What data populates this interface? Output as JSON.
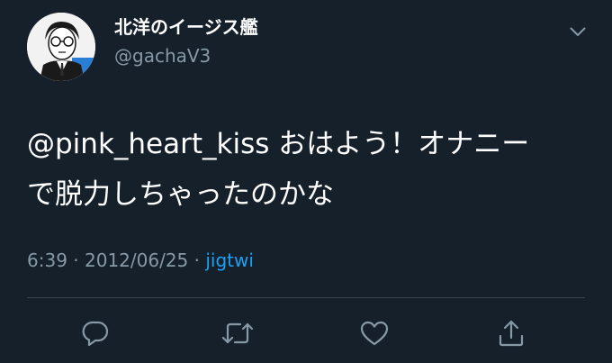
{
  "user": {
    "display_name": "北洋のイージス艦",
    "handle": "@gachaV3"
  },
  "tweet": {
    "mention": "@pink_heart_kiss",
    "line1_rest": " おはよう！オナニー",
    "line2": "で脱力しちゃったのかな"
  },
  "meta": {
    "time": "6:39",
    "sep1": " · ",
    "date": "2012/06/25",
    "sep2": " · ",
    "source": "jigtwi"
  },
  "icons": {
    "menu": "chevron-down-icon",
    "reply": "reply-icon",
    "retweet": "retweet-icon",
    "like": "heart-icon",
    "share": "share-icon"
  },
  "colors": {
    "background": "#15202b",
    "secondary_text": "#8899a6",
    "link": "#1da1f2",
    "divider": "#38444d"
  }
}
